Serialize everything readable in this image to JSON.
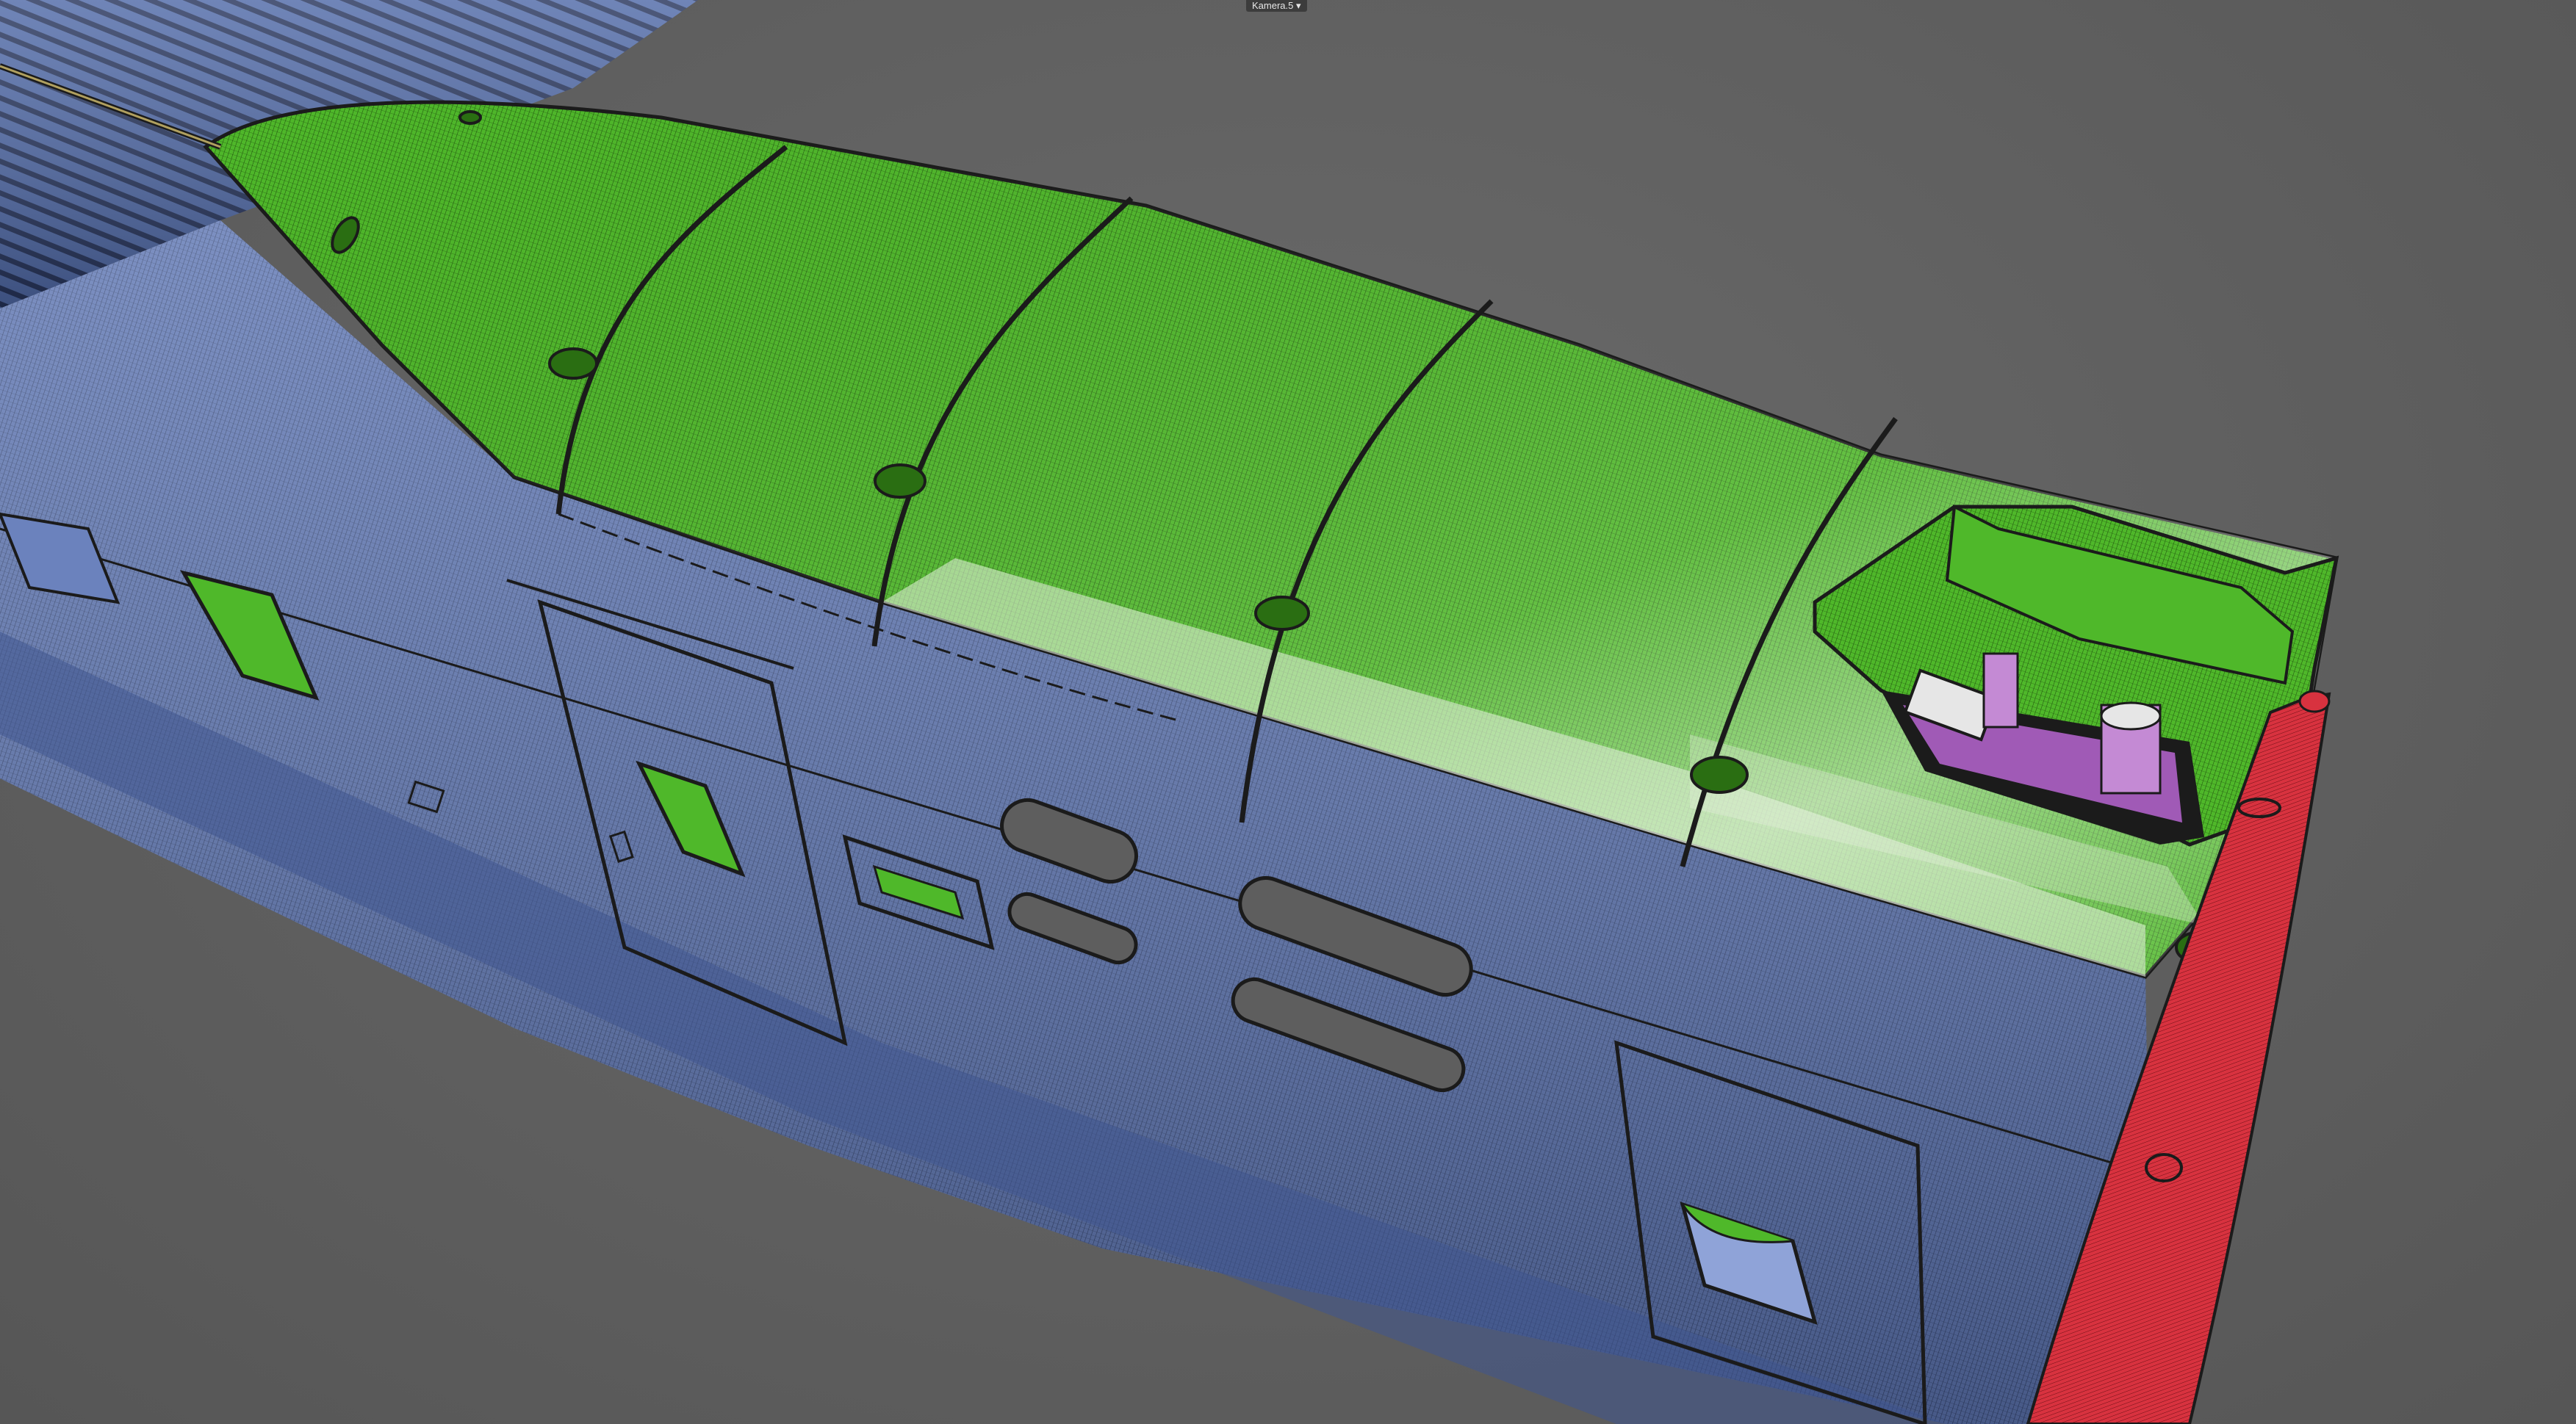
{
  "viewport": {
    "camera_label": "Kamera.5"
  },
  "colors": {
    "background": "#5e5e5e",
    "body_blue": "#5f77b4",
    "body_blue_dark": "#3f5690",
    "roof_green": "#4fb82a",
    "roof_green_light": "#7fe05a",
    "highlight_white": "#d9e6d0",
    "edge_black": "#1b1b1b",
    "bumper_red": "#d8323f",
    "machinery_purple": "#a05ab6"
  },
  "icons": {
    "camera_toggle": "dropdown-arrow-icon"
  }
}
